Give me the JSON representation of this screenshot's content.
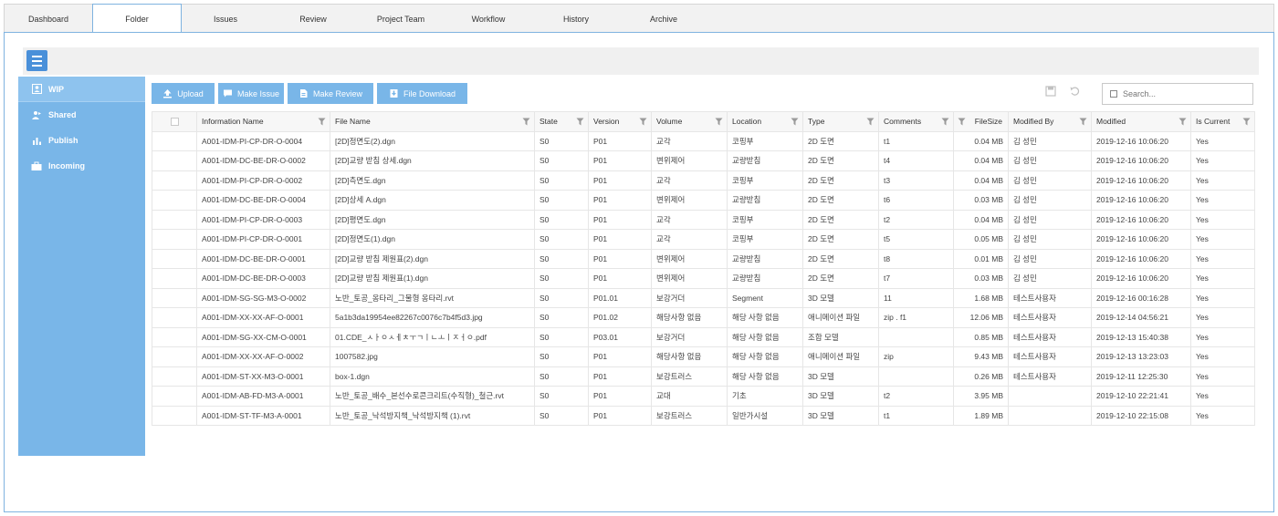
{
  "tabs": [
    {
      "label": "Dashboard",
      "width": 96,
      "active": false
    },
    {
      "label": "Folder",
      "width": 98,
      "active": true
    },
    {
      "label": "Issues",
      "width": 96,
      "active": false
    },
    {
      "label": "Review",
      "width": 96,
      "active": false
    },
    {
      "label": "Project Team",
      "width": 96,
      "active": false
    },
    {
      "label": "Workflow",
      "width": 96,
      "active": false
    },
    {
      "label": "History",
      "width": 96,
      "active": false
    },
    {
      "label": "Archive",
      "width": 96,
      "active": false
    }
  ],
  "sidebar": {
    "items": [
      {
        "label": "WIP",
        "icon": "user-icon",
        "active": true
      },
      {
        "label": "Shared",
        "icon": "share-icon",
        "active": false
      },
      {
        "label": "Publish",
        "icon": "bar-chart-icon",
        "active": false
      },
      {
        "label": "Incoming",
        "icon": "briefcase-icon",
        "active": false
      }
    ]
  },
  "toolbar": {
    "upload": "Upload",
    "make_issue": "Make Issue",
    "make_review": "Make Review",
    "file_download": "File Download"
  },
  "search": {
    "placeholder": "Search..."
  },
  "columns": [
    "Information Name",
    "File Name",
    "State",
    "Version",
    "Volume",
    "Location",
    "Type",
    "Comments",
    "FileSize",
    "Modified By",
    "Modified",
    "Is Current"
  ],
  "rows": [
    [
      "A001-IDM-PI-CP-DR-O-0004",
      "[2D]정면도(2).dgn",
      "S0",
      "P01",
      "교각",
      "코핑부",
      "2D 도면",
      "t1",
      "0.04 MB",
      "김 성민",
      "2019-12-16 10:06:20",
      "Yes"
    ],
    [
      "A001-IDM-DC-BE-DR-O-0002",
      "[2D]교량 받침 상세.dgn",
      "S0",
      "P01",
      "변위제어",
      "교량받침",
      "2D 도면",
      "t4",
      "0.04 MB",
      "김 성민",
      "2019-12-16 10:06:20",
      "Yes"
    ],
    [
      "A001-IDM-PI-CP-DR-O-0002",
      "[2D]측면도.dgn",
      "S0",
      "P01",
      "교각",
      "코핑부",
      "2D 도면",
      "t3",
      "0.04 MB",
      "김 성민",
      "2019-12-16 10:06:20",
      "Yes"
    ],
    [
      "A001-IDM-DC-BE-DR-O-0004",
      "[2D]상세 A.dgn",
      "S0",
      "P01",
      "변위제어",
      "교량받침",
      "2D 도면",
      "t6",
      "0.03 MB",
      "김 성민",
      "2019-12-16 10:06:20",
      "Yes"
    ],
    [
      "A001-IDM-PI-CP-DR-O-0003",
      "[2D]평면도.dgn",
      "S0",
      "P01",
      "교각",
      "코핑부",
      "2D 도면",
      "t2",
      "0.04 MB",
      "김 성민",
      "2019-12-16 10:06:20",
      "Yes"
    ],
    [
      "A001-IDM-PI-CP-DR-O-0001",
      "[2D]정면도(1).dgn",
      "S0",
      "P01",
      "교각",
      "코핑부",
      "2D 도면",
      "t5",
      "0.05 MB",
      "김 성민",
      "2019-12-16 10:06:20",
      "Yes"
    ],
    [
      "A001-IDM-DC-BE-DR-O-0001",
      "[2D]교량 받침 제원표(2).dgn",
      "S0",
      "P01",
      "변위제어",
      "교량받침",
      "2D 도면",
      "t8",
      "0.01 MB",
      "김 성민",
      "2019-12-16 10:06:20",
      "Yes"
    ],
    [
      "A001-IDM-DC-BE-DR-O-0003",
      "[2D]교량 받침 제원표(1).dgn",
      "S0",
      "P01",
      "변위제어",
      "교량받침",
      "2D 도면",
      "t7",
      "0.03 MB",
      "김 성민",
      "2019-12-16 10:06:20",
      "Yes"
    ],
    [
      "A001-IDM-SG-SG-M3-O-0002",
      "노반_토공_옹타리_그물형 옹타리.rvt",
      "S0",
      "P01.01",
      "보강거더",
      "Segment",
      "3D 모델",
      "11",
      "1.68 MB",
      "테스트사용자",
      "2019-12-16 00:16:28",
      "Yes"
    ],
    [
      "A001-IDM-XX-XX-AF-O-0001",
      "5a1b3da19954ee82267c0076c7b4f5d3.jpg",
      "S0",
      "P01.02",
      "해당사항 없음",
      "해당 사항 없음",
      "애니메이션 파일",
      "zip . f1",
      "12.06 MB",
      "테스트사용자",
      "2019-12-14 04:56:21",
      "Yes"
    ],
    [
      "A001-IDM-SG-XX-CM-O-0001",
      "01.CDE_ㅅㅏㅇㅅㅔㅊㅜㄱㅣㄴㅗㅣㅈㅓㅇ.pdf",
      "S0",
      "P03.01",
      "보강거더",
      "해당 사항 없음",
      "조합 모델",
      "",
      "0.85 MB",
      "테스트사용자",
      "2019-12-13 15:40:38",
      "Yes"
    ],
    [
      "A001-IDM-XX-XX-AF-O-0002",
      "1007582.jpg",
      "S0",
      "P01",
      "해당사항 없음",
      "해당 사항 없음",
      "애니메이션 파일",
      "zip",
      "9.43 MB",
      "테스트사용자",
      "2019-12-13 13:23:03",
      "Yes"
    ],
    [
      "A001-IDM-ST-XX-M3-O-0001",
      "box-1.dgn",
      "S0",
      "P01",
      "보강트러스",
      "해당 사항 없음",
      "3D 모델",
      "",
      "0.26 MB",
      "테스트사용자",
      "2019-12-11 12:25:30",
      "Yes"
    ],
    [
      "A001-IDM-AB-FD-M3-A-0001",
      "노반_토공_배수_본선수로콘크리트(수직형)_철근.rvt",
      "S0",
      "P01",
      "교대",
      "기초",
      "3D 모델",
      "t2",
      "3.95 MB",
      "",
      "2019-12-10 22:21:41",
      "Yes"
    ],
    [
      "A001-IDM-ST-TF-M3-A-0001",
      "노반_토공_낙석방지책_낙석방지책 (1).rvt",
      "S0",
      "P01",
      "보강트러스",
      "일반가시설",
      "3D 모델",
      "t1",
      "1.89 MB",
      "",
      "2019-12-10 22:15:08",
      "Yes"
    ]
  ]
}
